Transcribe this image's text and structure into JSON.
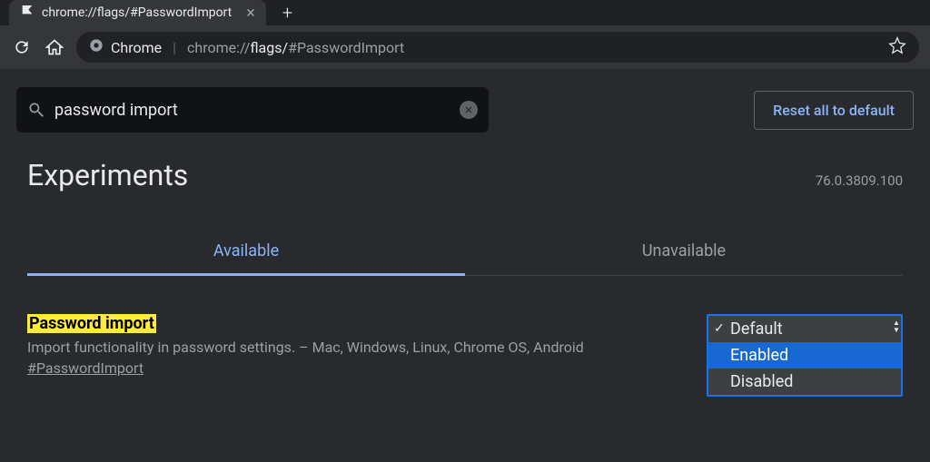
{
  "tab": {
    "title": "chrome://flags/#PasswordImport"
  },
  "omnibox": {
    "scheme": "Chrome",
    "path_prefix": "chrome://",
    "path_bold": "flags/",
    "hash": "#PasswordImport"
  },
  "search": {
    "value": "password import"
  },
  "reset_label": "Reset all to default",
  "page_title": "Experiments",
  "version": "76.0.3809.100",
  "tabs": {
    "available": "Available",
    "unavailable": "Unavailable"
  },
  "flag": {
    "title": "Password import",
    "description": "Import functionality in password settings. – Mac, Windows, Linux, Chrome OS, Android",
    "hash": "#PasswordImport",
    "options": {
      "default": "Default",
      "enabled": "Enabled",
      "disabled": "Disabled"
    }
  }
}
